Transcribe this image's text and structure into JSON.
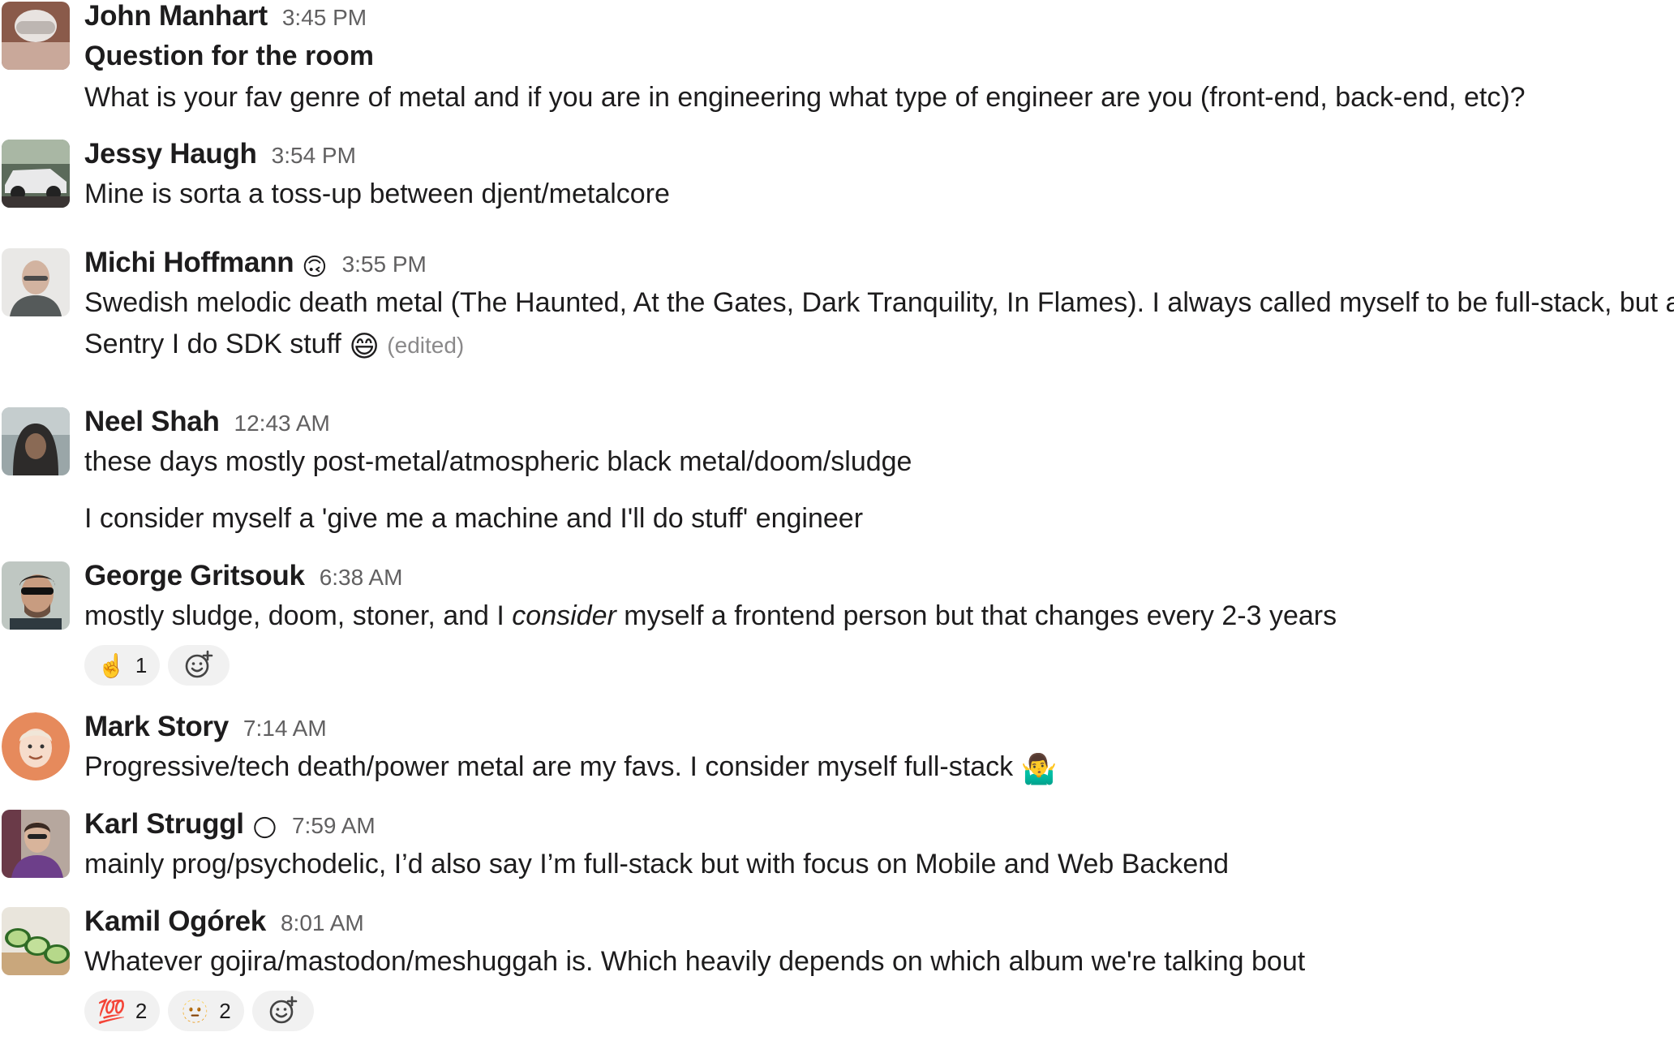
{
  "messages": [
    {
      "author": "John Manhart",
      "time": "3:45 PM",
      "lines": [
        "Question for the room",
        "What is your fav genre of metal and if you are in engineering what type of engineer are you (front-end, back-end, etc)?"
      ]
    },
    {
      "author": "Jessy Haugh",
      "time": "3:54 PM",
      "lines": [
        "Mine is sorta a toss-up between djent/metalcore"
      ]
    },
    {
      "author": "Michi Hoffmann",
      "status_emoji": "🙃",
      "time": "3:55 PM",
      "lines": [
        "Swedish melodic death metal (The Haunted, At the Gates, Dark Tranquility, In Flames). I always called myself to be full-stack, but a",
        "Sentry I do SDK stuff"
      ],
      "inline_emoji": "😄",
      "edited": "(edited)"
    },
    {
      "author": "Neel Shah",
      "time": "12:43 AM",
      "lines": [
        "these days mostly post-metal/atmospheric black metal/doom/sludge",
        "I consider myself a 'give me a machine and I'll do stuff' engineer"
      ]
    },
    {
      "author": "George Gritsouk",
      "time": "6:38 AM",
      "line_parts": {
        "before": "mostly sludge, doom, stoner, and I ",
        "italic": "consider",
        "after": " myself a frontend person but that changes every 2-3 years"
      },
      "reactions": [
        {
          "emoji": "☝️",
          "count": "1"
        }
      ]
    },
    {
      "author": "Mark Story",
      "time": "7:14 AM",
      "lines": [
        "Progressive/tech death/power metal are my favs. I consider myself full-stack"
      ],
      "inline_emoji": "🤷‍♂️"
    },
    {
      "author": "Karl Struggl",
      "status_emoji": "🌕",
      "time": "7:59 AM",
      "lines": [
        "mainly prog/psychodelic, I’d also say I’m full-stack but with focus on Mobile and Web Backend"
      ]
    },
    {
      "author": "Kamil Ogórek",
      "time": "8:01 AM",
      "lines": [
        "Whatever gojira/mastodon/meshuggah is. Which heavily depends on which album we're talking bout"
      ],
      "reactions": [
        {
          "emoji": "💯",
          "count": "2"
        },
        {
          "emoji": "🫥",
          "count": "2"
        }
      ]
    }
  ],
  "icons": {
    "add_reaction": "add-reaction-icon"
  }
}
